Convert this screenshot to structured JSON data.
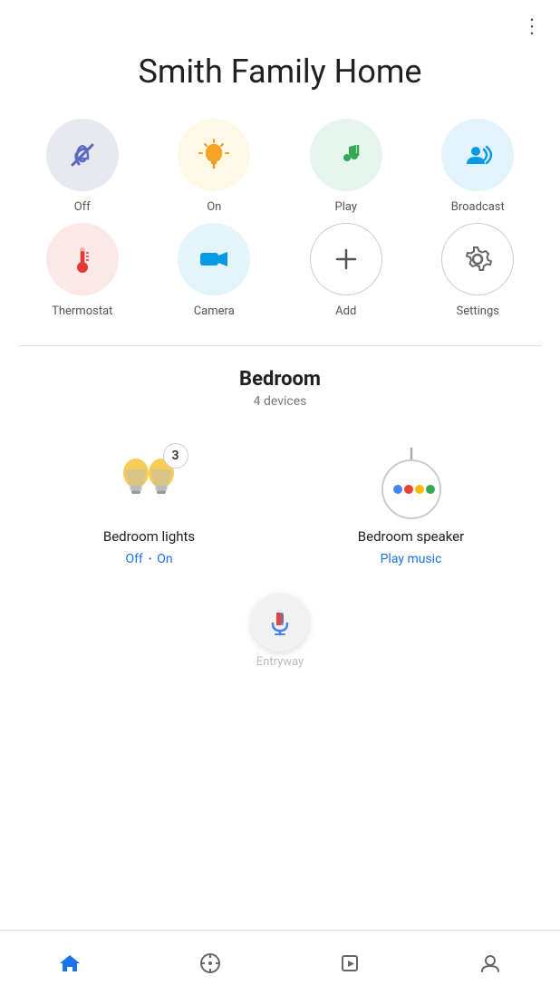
{
  "header": {
    "more_button": "⋮",
    "title": "Smith Family Home"
  },
  "shortcuts": [
    {
      "id": "off",
      "label": "Off",
      "circle_class": "circle-off",
      "icon_type": "off"
    },
    {
      "id": "on",
      "label": "On",
      "circle_class": "circle-on",
      "icon_type": "on"
    },
    {
      "id": "play",
      "label": "Play",
      "circle_class": "circle-play",
      "icon_type": "play"
    },
    {
      "id": "broadcast",
      "label": "Broadcast",
      "circle_class": "circle-broadcast",
      "icon_type": "broadcast"
    },
    {
      "id": "thermostat",
      "label": "Thermostat",
      "circle_class": "circle-thermostat",
      "icon_type": "thermostat"
    },
    {
      "id": "camera",
      "label": "Camera",
      "circle_class": "circle-camera",
      "icon_type": "camera"
    },
    {
      "id": "add",
      "label": "Add",
      "circle_class": "circle-add",
      "icon_type": "add"
    },
    {
      "id": "settings",
      "label": "Settings",
      "circle_class": "circle-settings",
      "icon_type": "settings"
    }
  ],
  "room": {
    "name": "Bedroom",
    "device_count": "4 devices"
  },
  "devices": [
    {
      "id": "bedroom-lights",
      "name": "Bedroom lights",
      "status_type": "multi",
      "status_off": "Off",
      "status_on": "On",
      "badge": "3"
    },
    {
      "id": "bedroom-speaker",
      "name": "Bedroom speaker",
      "status_type": "action",
      "action": "Play music"
    }
  ],
  "bottom_nav": [
    {
      "id": "home",
      "label": "",
      "active": true
    },
    {
      "id": "explore",
      "label": ""
    },
    {
      "id": "routines",
      "label": ""
    },
    {
      "id": "account",
      "label": ""
    }
  ],
  "entryway_label": "Entryway",
  "colors": {
    "dot_blue": "#4285F4",
    "dot_red": "#EA4335",
    "dot_yellow": "#FBBC05",
    "dot_green": "#34A853"
  }
}
